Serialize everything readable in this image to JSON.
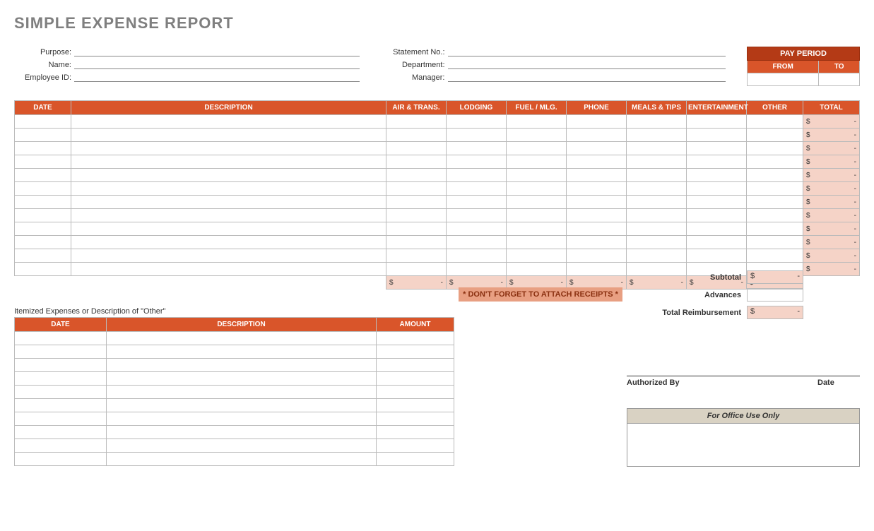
{
  "title": "SIMPLE EXPENSE REPORT",
  "fieldsLeft": {
    "purpose": "Purpose:",
    "name": "Name:",
    "employeeId": "Employee ID:"
  },
  "fieldsRight": {
    "statementNo": "Statement No.:",
    "department": "Department:",
    "manager": "Manager:"
  },
  "payPeriod": {
    "title": "PAY PERIOD",
    "from": "FROM",
    "to": "TO"
  },
  "columns": {
    "date": "DATE",
    "description": "DESCRIPTION",
    "airTrans": "AIR & TRANS.",
    "lodging": "LODGING",
    "fuelMlg": "FUEL / MLG.",
    "phone": "PHONE",
    "mealsTips": "MEALS & TIPS",
    "entertainment": "ENTERTAINMENT",
    "other": "OTHER",
    "total": "TOTAL"
  },
  "money": {
    "symbol": "$",
    "dash": "-"
  },
  "summary": {
    "subtotal": "Subtotal",
    "advances": "Advances",
    "totalReimbursement": "Total Reimbursement"
  },
  "receiptNote": "* DON'T FORGET TO ATTACH RECEIPTS *",
  "itemized": {
    "title": "Itemized Expenses or Description of \"Other\"",
    "cols": {
      "date": "DATE",
      "description": "DESCRIPTION",
      "amount": "AMOUNT"
    }
  },
  "auth": {
    "by": "Authorized By",
    "date": "Date"
  },
  "office": {
    "title": "For Office Use Only"
  }
}
